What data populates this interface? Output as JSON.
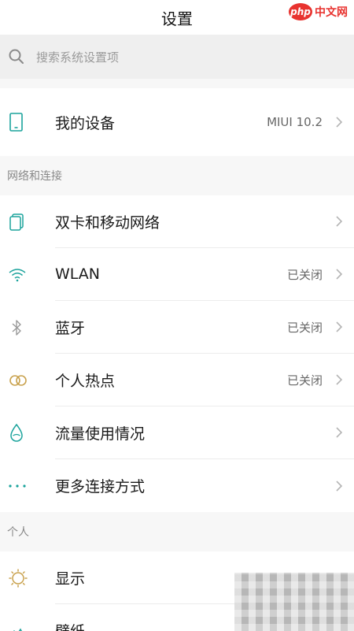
{
  "header": {
    "title": "设置",
    "watermark_logo": "php",
    "watermark_text": "中文网"
  },
  "search": {
    "placeholder": "搜索系统设置项"
  },
  "device": {
    "label": "我的设备",
    "value": "MIUI 10.2"
  },
  "network_section": {
    "title": "网络和连接",
    "items": [
      {
        "label": "双卡和移动网络",
        "value": "",
        "icon": "sim-card-icon"
      },
      {
        "label": "WLAN",
        "value": "已关闭",
        "icon": "wifi-icon"
      },
      {
        "label": "蓝牙",
        "value": "已关闭",
        "icon": "bluetooth-icon"
      },
      {
        "label": "个人热点",
        "value": "已关闭",
        "icon": "hotspot-icon"
      },
      {
        "label": "流量使用情况",
        "value": "",
        "icon": "data-drop-icon"
      },
      {
        "label": "更多连接方式",
        "value": "",
        "icon": "more-dots-icon"
      }
    ]
  },
  "personal_section": {
    "title": "个人",
    "items": [
      {
        "label": "显示",
        "icon": "brightness-icon"
      },
      {
        "label": "壁纸",
        "icon": "wallpaper-icon"
      }
    ]
  },
  "colors": {
    "accent": "#1ba39c",
    "hotspot": "#c9a24e",
    "text": "#1a1a1a",
    "muted": "#888888"
  }
}
